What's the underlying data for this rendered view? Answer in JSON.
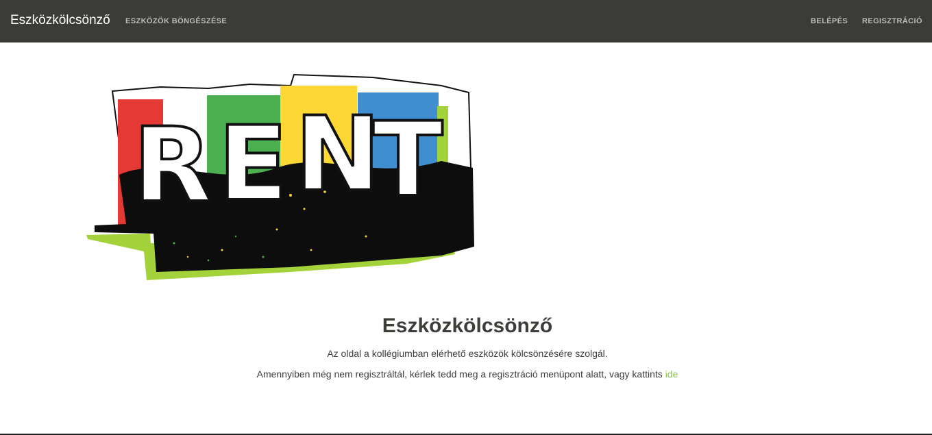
{
  "navbar": {
    "brand": "Eszközkölcsönző",
    "browse_label": "ESZKÖZÖK BÖNGÉSZÉSE",
    "login_label": "BELÉPÉS",
    "register_label": "REGISZTRÁCIÓ",
    "background": "#3b3b37"
  },
  "logo": {
    "letters": [
      "R",
      "E",
      "N",
      "T"
    ],
    "icon": "rent-logo",
    "colors": {
      "red": "#e53935",
      "green": "#4caf50",
      "yellow": "#fdd835",
      "blue": "#3f8fd0",
      "lime": "#a4d23a"
    }
  },
  "hero": {
    "title": "Eszközkölcsönző",
    "description": "Az oldal a kollégiumban elérhető eszközök kölcsönzésére szolgál.",
    "register_prompt": "Amennyiben még nem regisztráltál, kérlek tedd meg a regisztráció menüpont alatt, vagy kattints",
    "register_link": "ide",
    "link_color": "#8bc34a"
  }
}
